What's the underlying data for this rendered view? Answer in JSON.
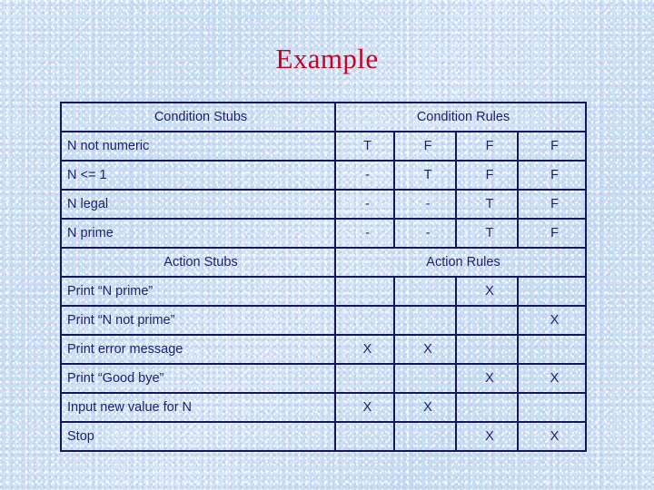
{
  "title": "Example",
  "colors": {
    "title": "#cc0022",
    "text": "#1f1f6e",
    "border": "#16165c",
    "background": "#cde3f6"
  },
  "table": {
    "condition_header": {
      "stubs_label": "Condition Stubs",
      "rules_label": "Condition Rules"
    },
    "condition_rows": [
      {
        "stub": "N not numeric",
        "rules": [
          "T",
          "F",
          "F",
          "F"
        ]
      },
      {
        "stub": "N <= 1",
        "rules": [
          "-",
          "T",
          "F",
          "F"
        ]
      },
      {
        "stub": "N legal",
        "rules": [
          "-",
          "-",
          "T",
          "F"
        ]
      },
      {
        "stub": "N prime",
        "rules": [
          "-",
          "-",
          "T",
          "F"
        ]
      }
    ],
    "action_header": {
      "stubs_label": "Action Stubs",
      "rules_label": "Action Rules"
    },
    "action_rows": [
      {
        "stub": "Print “N prime”",
        "rules": [
          "",
          "",
          "X",
          ""
        ]
      },
      {
        "stub": "Print “N not prime”",
        "rules": [
          "",
          "",
          "",
          "X"
        ]
      },
      {
        "stub": "Print error message",
        "rules": [
          "X",
          "X",
          "",
          ""
        ]
      },
      {
        "stub": "Print “Good bye”",
        "rules": [
          "",
          "",
          "X",
          "X"
        ]
      },
      {
        "stub": "Input new value for N",
        "rules": [
          "X",
          "X",
          "",
          ""
        ]
      },
      {
        "stub": "Stop",
        "rules": [
          "",
          "",
          "X",
          "X"
        ]
      }
    ]
  }
}
